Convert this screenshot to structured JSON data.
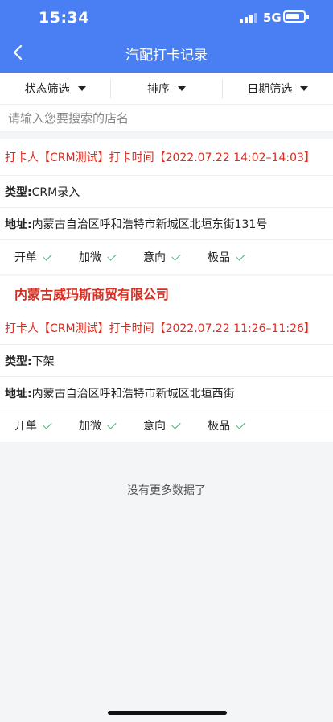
{
  "status_bar": {
    "time": "15:34",
    "network": "5G",
    "battery_level": 0.8
  },
  "nav": {
    "title": "汽配打卡记录",
    "back_icon": "chevron-left-icon"
  },
  "filters": [
    {
      "label": "状态筛选"
    },
    {
      "label": "排序"
    },
    {
      "label": "日期筛选"
    }
  ],
  "search": {
    "placeholder": "请输入您要搜索的店名",
    "value": ""
  },
  "records": [
    {
      "store_name": "",
      "checkin": "打卡人【CRM测试】打卡时间【2022.07.22 14:02–14:03】",
      "type_label": "类型:",
      "type_value": "CRM录入",
      "address_label": "地址:",
      "address_value": "内蒙古自治区呼和浩特市新城区北垣东街131号",
      "tags": [
        "开单",
        "加微",
        "意向",
        "极品"
      ]
    },
    {
      "store_name": "内蒙古威玛斯商贸有限公司",
      "checkin": "打卡人【CRM测试】打卡时间【2022.07.22 11:26–11:26】",
      "type_label": "类型:",
      "type_value": "下架",
      "address_label": "地址:",
      "address_value": "内蒙古自治区呼和浩特市新城区北垣西街",
      "tags": [
        "开单",
        "加微",
        "意向",
        "极品"
      ]
    }
  ],
  "footer": {
    "no_more": "没有更多数据了"
  },
  "colors": {
    "primary": "#4a7ff3",
    "accent_red": "#d92d20",
    "check_green": "#3cb371"
  }
}
